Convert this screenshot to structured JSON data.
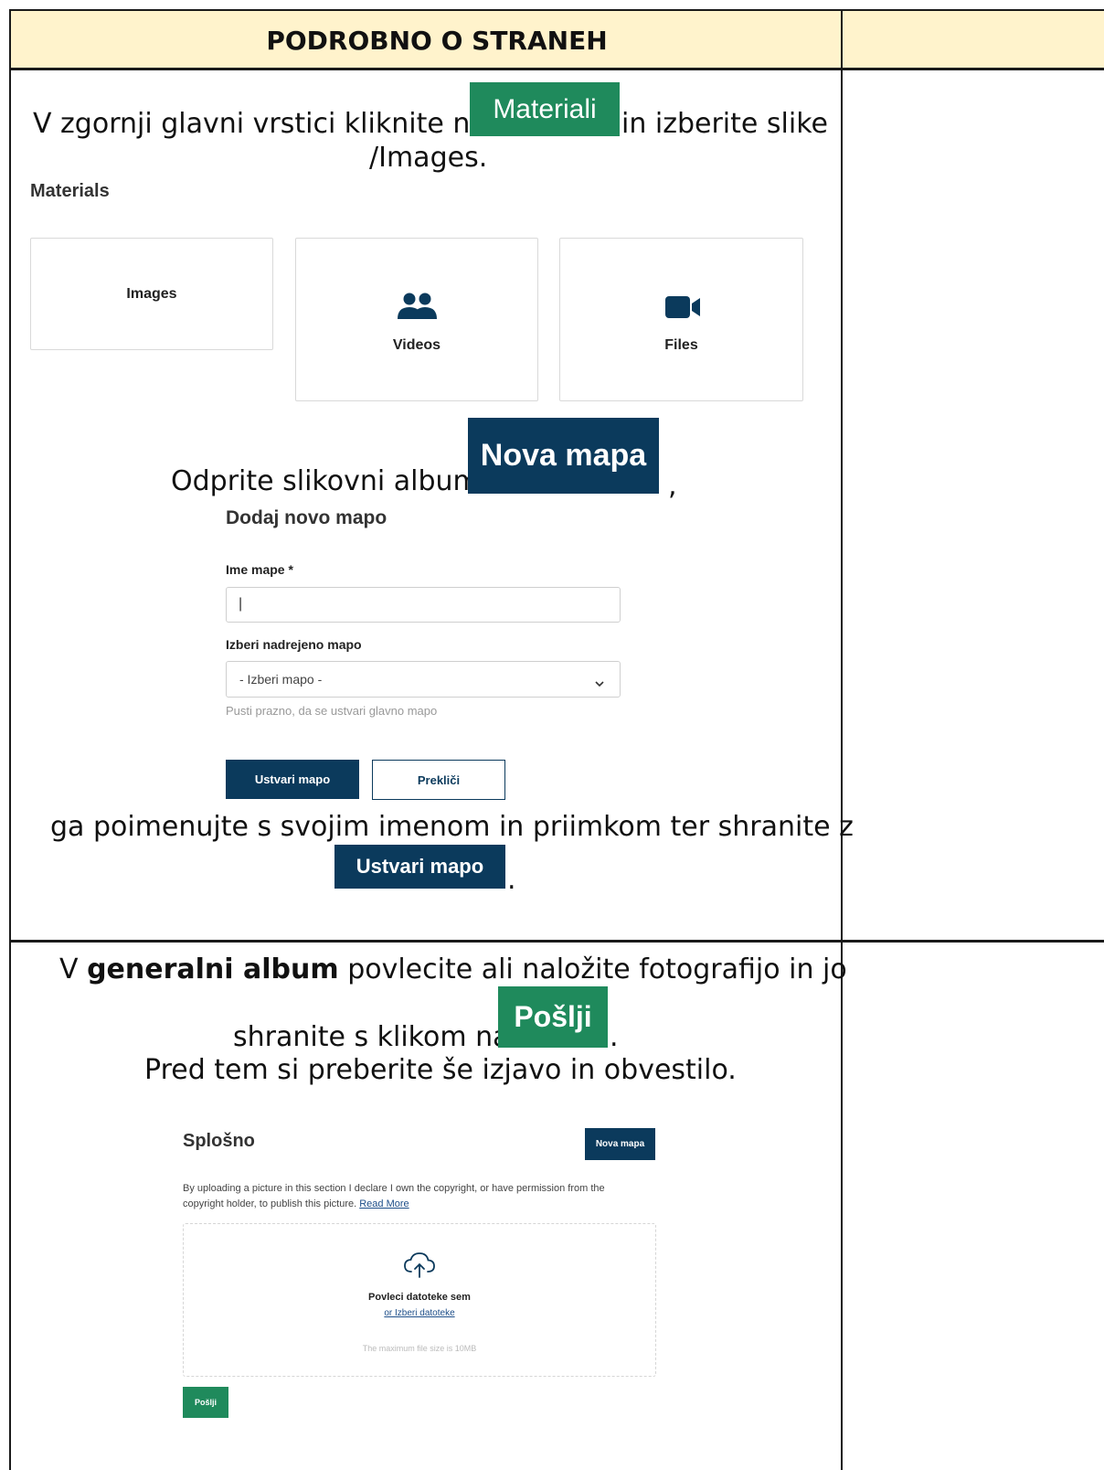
{
  "header": {
    "title": "PODROBNO O STRANEH"
  },
  "step1": {
    "text_before": "V zgornji glavni vrstici kliknite na",
    "button_label": "Materiali",
    "text_after": "in izberite slike",
    "text_line2": "/Images.",
    "materials": {
      "title": "Materials",
      "cards": [
        {
          "label": "Images"
        },
        {
          "label": "Videos",
          "icon": "users-icon"
        },
        {
          "label": "Files",
          "icon": "video-camera-icon"
        }
      ]
    }
  },
  "step2": {
    "text_before": "Odprite slikovni album",
    "button_label": "Nova mapa",
    "text_after": ",",
    "form": {
      "title": "Dodaj novo mapo",
      "name_label": "Ime mape *",
      "name_value": "|",
      "parent_label": "Izberi nadrejeno mapo",
      "parent_value": "- Izberi mapo -",
      "hint": "Pusti prazno, da se ustvari glavno mapo",
      "create_label": "Ustvari mapo",
      "cancel_label": "Prekliči"
    },
    "text_save": "ga poimenujte s svojim imenom in priimkom ter shranite z",
    "save_button_label": "Ustvari mapo",
    "text_end": "."
  },
  "step3": {
    "text_v": "V",
    "text_bold": "generalni album",
    "text_rest": "povlecite ali naložite fotografijo in jo",
    "text_line2": "shranite s klikom na",
    "button_label": "Pošlji",
    "text_end": ".",
    "text_line3": "Pred tem si preberite še izjavo in obvestilo.",
    "upload": {
      "title": "Splošno",
      "new_folder_label": "Nova mapa",
      "declaration_line1": "By uploading a picture in this section I declare I own the copyright, or have permission from the",
      "declaration_line2": "copyright holder, to publish this picture.",
      "read_more": "Read More",
      "drop_title": "Povleci datoteke sem",
      "drop_link": "or Izberi datoteke",
      "max_size": "The maximum file size is 10MB",
      "send_label": "Pošlji"
    }
  },
  "colors": {
    "header_bg": "#fff3cc",
    "green": "#1f8a5c",
    "navy": "#0b3a5c"
  }
}
